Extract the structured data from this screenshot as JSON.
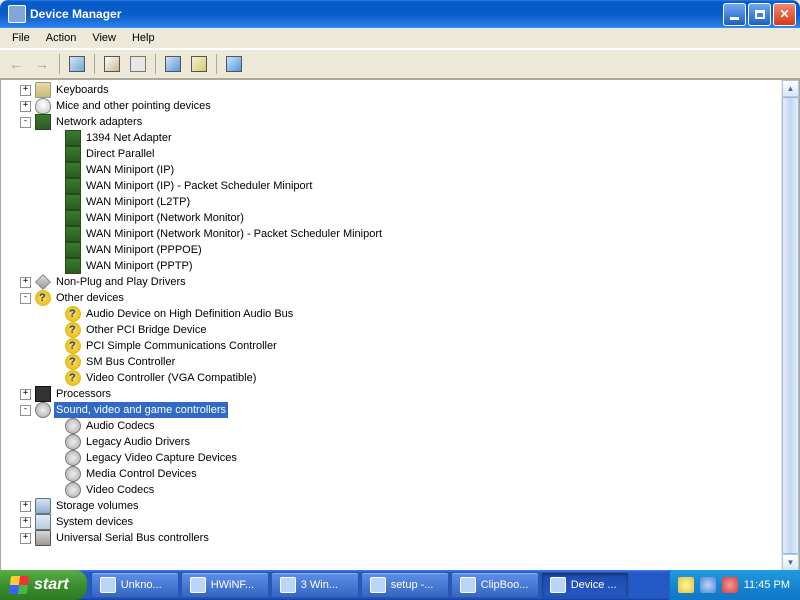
{
  "window": {
    "title": "Device Manager"
  },
  "menu": {
    "file": "File",
    "action": "Action",
    "view": "View",
    "help": "Help"
  },
  "tree": {
    "keyboards": {
      "label": "Keyboards",
      "type": "kb"
    },
    "mice": {
      "label": "Mice and other pointing devices",
      "type": "mouse"
    },
    "netadapters": {
      "label": "Network adapters",
      "type": "net"
    },
    "net1": {
      "label": "1394 Net Adapter"
    },
    "net2": {
      "label": "Direct Parallel"
    },
    "net3": {
      "label": "WAN Miniport (IP)"
    },
    "net4": {
      "label": "WAN Miniport (IP) - Packet Scheduler Miniport"
    },
    "net5": {
      "label": "WAN Miniport (L2TP)"
    },
    "net6": {
      "label": "WAN Miniport (Network Monitor)"
    },
    "net7": {
      "label": "WAN Miniport (Network Monitor) - Packet Scheduler Miniport"
    },
    "net8": {
      "label": "WAN Miniport (PPPOE)"
    },
    "net9": {
      "label": "WAN Miniport (PPTP)"
    },
    "nonpnp": {
      "label": "Non-Plug and Play Drivers",
      "type": "nonpnp"
    },
    "other": {
      "label": "Other devices",
      "type": "unk"
    },
    "oth1": {
      "label": "Audio Device on High Definition Audio Bus"
    },
    "oth2": {
      "label": "Other PCI Bridge Device"
    },
    "oth3": {
      "label": "PCI Simple Communications Controller"
    },
    "oth4": {
      "label": "SM Bus Controller"
    },
    "oth5": {
      "label": "Video Controller (VGA Compatible)"
    },
    "processors": {
      "label": "Processors",
      "type": "cpu"
    },
    "sound": {
      "label": "Sound, video and game controllers",
      "type": "snd",
      "selected": true
    },
    "s1": {
      "label": "Audio Codecs"
    },
    "s2": {
      "label": "Legacy Audio Drivers"
    },
    "s3": {
      "label": "Legacy Video Capture Devices"
    },
    "s4": {
      "label": "Media Control Devices"
    },
    "s5": {
      "label": "Video Codecs"
    },
    "storage": {
      "label": "Storage volumes",
      "type": "stor"
    },
    "system": {
      "label": "System devices",
      "type": "sys"
    },
    "usb": {
      "label": "Universal Serial Bus controllers",
      "type": "usb"
    }
  },
  "taskbar": {
    "start": "start",
    "items": [
      {
        "label": "Unkno..."
      },
      {
        "label": "HWiNF..."
      },
      {
        "label": "3 Win..."
      },
      {
        "label": "setup -..."
      },
      {
        "label": "ClipBoo..."
      },
      {
        "label": "Device ...",
        "active": true
      }
    ],
    "clock": "11:45 PM"
  }
}
